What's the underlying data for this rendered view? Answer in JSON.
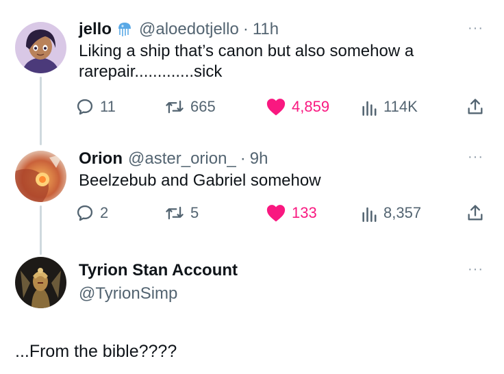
{
  "tweets": [
    {
      "name": "jello",
      "handle": "@aloedotjello",
      "separator": "·",
      "time": "11h",
      "text": "Liking a ship that’s canon but also somehow a rarepair.............sick",
      "replies": "11",
      "retweets": "665",
      "likes": "4,859",
      "views": "114K"
    },
    {
      "name": "Orion",
      "handle": "@aster_orion_",
      "separator": "·",
      "time": "9h",
      "text": "Beelzebub and Gabriel somehow",
      "replies": "2",
      "retweets": "5",
      "likes": "133",
      "views": "8,357"
    },
    {
      "name": "Tyrion Stan Account",
      "handle": "@TyrionSimp",
      "text": "...From the bible????"
    }
  ],
  "icons": {
    "verified": "jellyfish-badge-icon",
    "reply": "reply-icon",
    "retweet": "retweet-icon",
    "like": "heart-icon",
    "views": "views-icon",
    "share": "share-icon",
    "more": "more-icon"
  },
  "colors": {
    "like": "#f91880",
    "muted": "#536471",
    "thread_line": "#cfd9de"
  },
  "more_glyph": "···"
}
